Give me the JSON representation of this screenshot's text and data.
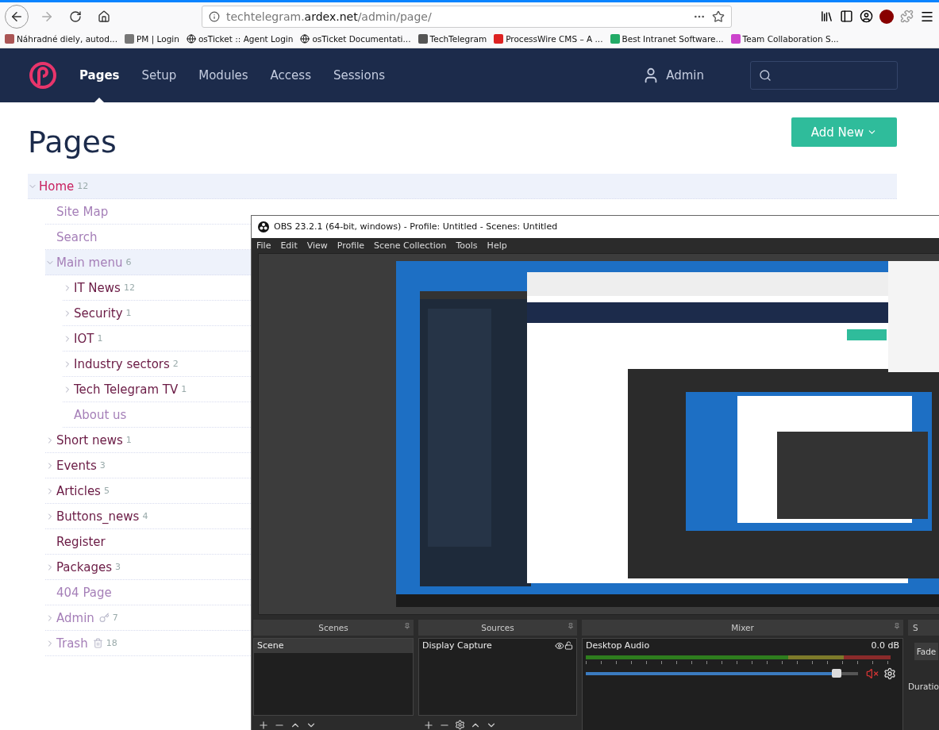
{
  "browser": {
    "url": "techtelegram.**ardex.net**/admin/page/",
    "bookmarks": [
      {
        "label": "Náhradné diely, autod..."
      },
      {
        "label": "PM | Login"
      },
      {
        "label": "osTicket :: Agent Login"
      },
      {
        "label": "osTicket Documentati..."
      },
      {
        "label": "TechTelegram"
      },
      {
        "label": "ProcessWire CMS – A ..."
      },
      {
        "label": "Best Intranet Software..."
      },
      {
        "label": "Team Collaboration S..."
      }
    ]
  },
  "nav": {
    "items": [
      {
        "label": "Pages",
        "selected": true
      },
      {
        "label": "Setup",
        "selected": false
      },
      {
        "label": "Modules",
        "selected": false
      },
      {
        "label": "Access",
        "selected": false
      },
      {
        "label": "Sessions",
        "selected": false
      }
    ],
    "user": "Admin"
  },
  "page": {
    "title": "Pages",
    "add_button": "Add New",
    "tree": [
      {
        "label": "Home",
        "count": "12",
        "expanded": true,
        "hidden": false,
        "children": [
          {
            "kind": "page",
            "label": "Site Map",
            "expanded": false,
            "hidden": true
          },
          {
            "kind": "page",
            "label": "Search",
            "expanded": false,
            "hidden": true
          },
          {
            "kind": "page",
            "label": "Main menu",
            "count": "6",
            "expanded": true,
            "hidden": true,
            "children": [
              {
                "label": "IT News",
                "count": "12",
                "expanded": false,
                "hidden": false
              },
              {
                "label": "Security",
                "count": "1",
                "expanded": false,
                "hidden": false
              },
              {
                "label": "IOT",
                "count": "1",
                "expanded": false,
                "hidden": false
              },
              {
                "label": "Industry sectors",
                "count": "2",
                "expanded": false,
                "hidden": false
              },
              {
                "label": "Tech Telegram TV",
                "count": "1",
                "expanded": false,
                "hidden": false
              },
              {
                "label": "About us",
                "expanded": false,
                "hidden": true
              }
            ]
          },
          {
            "kind": "page",
            "label": "Short news",
            "count": "1",
            "expanded": false,
            "hidden": false
          },
          {
            "kind": "page",
            "label": "Events",
            "count": "3",
            "expanded": false,
            "hidden": false
          },
          {
            "kind": "page",
            "label": "Articles",
            "count": "5",
            "expanded": false,
            "hidden": false
          },
          {
            "kind": "page",
            "label": "Buttons_news",
            "count": "4",
            "expanded": false,
            "hidden": false
          },
          {
            "kind": "page",
            "label": "Register",
            "expanded": false,
            "hidden": false
          },
          {
            "kind": "page",
            "label": "Packages",
            "count": "3",
            "expanded": false,
            "hidden": false
          },
          {
            "kind": "page",
            "label": "404 Page",
            "expanded": false,
            "hidden": true
          },
          {
            "kind": "admin",
            "label": "Admin",
            "count": "7",
            "expanded": false,
            "hidden": true
          },
          {
            "kind": "trash",
            "label": "Trash",
            "count": "18",
            "expanded": false,
            "hidden": true
          }
        ]
      }
    ]
  },
  "obs": {
    "title": "OBS 23.2.1 (64-bit, windows) - Profile: Untitled - Scenes: Untitled",
    "menu": [
      "File",
      "Edit",
      "View",
      "Profile",
      "Scene Collection",
      "Tools",
      "Help"
    ],
    "preview": {
      "kind": "picture"
    },
    "scenes": {
      "title": "Scenes",
      "items": [
        {
          "label": "Scene",
          "selected": true
        }
      ]
    },
    "sources": {
      "title": "Sources",
      "items": [
        {
          "label": "Display Capture",
          "visible": true,
          "locked": false
        }
      ]
    },
    "mixer": {
      "title": "Mixer",
      "channels": [
        {
          "name": "Desktop Audio",
          "reading": "0.0 dB",
          "level": 0.94,
          "muted": true
        }
      ]
    },
    "transitions": {
      "title": "S",
      "value": "Fade",
      "duration_label": "Duratio"
    }
  }
}
